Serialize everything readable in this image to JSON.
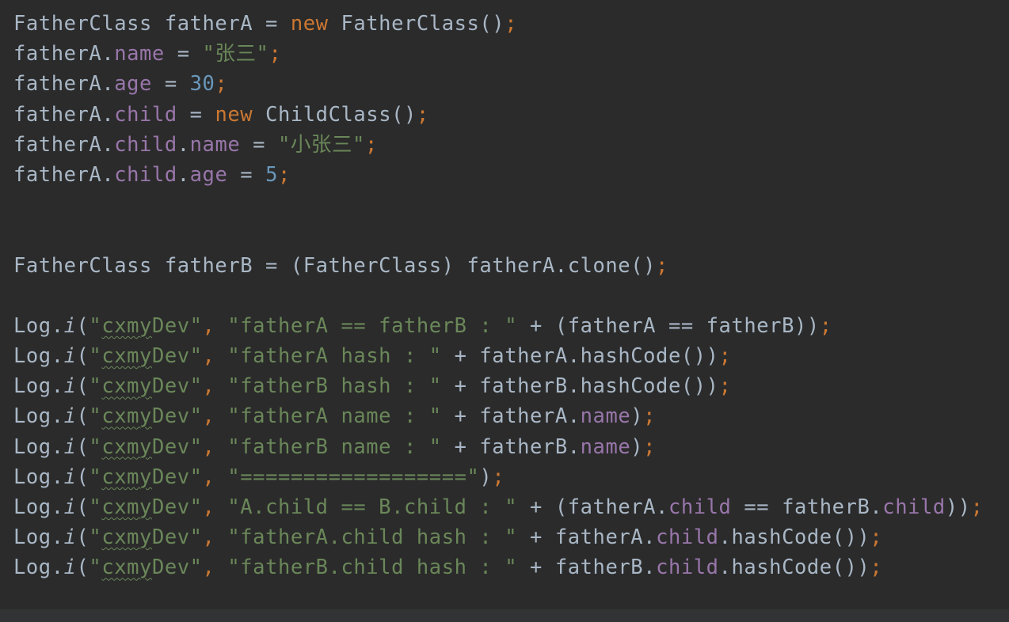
{
  "editor": {
    "colors": {
      "background": "#2b2b2b",
      "default_text": "#a9b7c6",
      "keyword": "#cc7832",
      "field": "#9876aa",
      "number": "#6897bb",
      "string": "#6a8759"
    },
    "lines": [
      [
        {
          "t": "FatherClass fatherA = ",
          "c": "plain"
        },
        {
          "t": "new",
          "c": "kw"
        },
        {
          "t": " FatherClass()",
          "c": "plain"
        },
        {
          "t": ";",
          "c": "punc"
        }
      ],
      [
        {
          "t": "fatherA.",
          "c": "plain"
        },
        {
          "t": "name",
          "c": "field"
        },
        {
          "t": " = ",
          "c": "plain"
        },
        {
          "t": "\"张三\"",
          "c": "str"
        },
        {
          "t": ";",
          "c": "punc"
        }
      ],
      [
        {
          "t": "fatherA.",
          "c": "plain"
        },
        {
          "t": "age",
          "c": "field"
        },
        {
          "t": " = ",
          "c": "plain"
        },
        {
          "t": "30",
          "c": "num"
        },
        {
          "t": ";",
          "c": "punc"
        }
      ],
      [
        {
          "t": "fatherA.",
          "c": "plain"
        },
        {
          "t": "child",
          "c": "field"
        },
        {
          "t": " = ",
          "c": "plain"
        },
        {
          "t": "new",
          "c": "kw"
        },
        {
          "t": " ChildClass()",
          "c": "plain"
        },
        {
          "t": ";",
          "c": "punc"
        }
      ],
      [
        {
          "t": "fatherA.",
          "c": "plain"
        },
        {
          "t": "child",
          "c": "field"
        },
        {
          "t": ".",
          "c": "plain"
        },
        {
          "t": "name",
          "c": "field"
        },
        {
          "t": " = ",
          "c": "plain"
        },
        {
          "t": "\"小张三\"",
          "c": "str"
        },
        {
          "t": ";",
          "c": "punc"
        }
      ],
      [
        {
          "t": "fatherA.",
          "c": "plain"
        },
        {
          "t": "child",
          "c": "field"
        },
        {
          "t": ".",
          "c": "plain"
        },
        {
          "t": "age",
          "c": "field"
        },
        {
          "t": " = ",
          "c": "plain"
        },
        {
          "t": "5",
          "c": "num"
        },
        {
          "t": ";",
          "c": "punc"
        }
      ],
      [],
      [],
      [
        {
          "t": "FatherClass fatherB = (FatherClass) fatherA.clone()",
          "c": "plain"
        },
        {
          "t": ";",
          "c": "punc"
        }
      ],
      [],
      [
        {
          "t": "Log.",
          "c": "plain"
        },
        {
          "t": "i",
          "c": "method"
        },
        {
          "t": "(",
          "c": "plain"
        },
        {
          "t": "\"",
          "c": "str"
        },
        {
          "t": "cxmy",
          "c": "str typo"
        },
        {
          "t": "Dev\"",
          "c": "str"
        },
        {
          "t": ", ",
          "c": "punc"
        },
        {
          "t": "\"fatherA == fatherB : \"",
          "c": "str"
        },
        {
          "t": " + (fatherA == fatherB))",
          "c": "plain"
        },
        {
          "t": ";",
          "c": "punc"
        }
      ],
      [
        {
          "t": "Log.",
          "c": "plain"
        },
        {
          "t": "i",
          "c": "method"
        },
        {
          "t": "(",
          "c": "plain"
        },
        {
          "t": "\"",
          "c": "str"
        },
        {
          "t": "cxmy",
          "c": "str typo"
        },
        {
          "t": "Dev\"",
          "c": "str"
        },
        {
          "t": ", ",
          "c": "punc"
        },
        {
          "t": "\"fatherA hash : \"",
          "c": "str"
        },
        {
          "t": " + fatherA.hashCode())",
          "c": "plain"
        },
        {
          "t": ";",
          "c": "punc"
        }
      ],
      [
        {
          "t": "Log.",
          "c": "plain"
        },
        {
          "t": "i",
          "c": "method"
        },
        {
          "t": "(",
          "c": "plain"
        },
        {
          "t": "\"",
          "c": "str"
        },
        {
          "t": "cxmy",
          "c": "str typo"
        },
        {
          "t": "Dev\"",
          "c": "str"
        },
        {
          "t": ", ",
          "c": "punc"
        },
        {
          "t": "\"fatherB hash : \"",
          "c": "str"
        },
        {
          "t": " + fatherB.hashCode())",
          "c": "plain"
        },
        {
          "t": ";",
          "c": "punc"
        }
      ],
      [
        {
          "t": "Log.",
          "c": "plain"
        },
        {
          "t": "i",
          "c": "method"
        },
        {
          "t": "(",
          "c": "plain"
        },
        {
          "t": "\"",
          "c": "str"
        },
        {
          "t": "cxmy",
          "c": "str typo"
        },
        {
          "t": "Dev\"",
          "c": "str"
        },
        {
          "t": ", ",
          "c": "punc"
        },
        {
          "t": "\"fatherA name : \"",
          "c": "str"
        },
        {
          "t": " + fatherA.",
          "c": "plain"
        },
        {
          "t": "name",
          "c": "field"
        },
        {
          "t": ")",
          "c": "plain"
        },
        {
          "t": ";",
          "c": "punc"
        }
      ],
      [
        {
          "t": "Log.",
          "c": "plain"
        },
        {
          "t": "i",
          "c": "method"
        },
        {
          "t": "(",
          "c": "plain"
        },
        {
          "t": "\"",
          "c": "str"
        },
        {
          "t": "cxmy",
          "c": "str typo"
        },
        {
          "t": "Dev\"",
          "c": "str"
        },
        {
          "t": ", ",
          "c": "punc"
        },
        {
          "t": "\"fatherB name : \"",
          "c": "str"
        },
        {
          "t": " + fatherB.",
          "c": "plain"
        },
        {
          "t": "name",
          "c": "field"
        },
        {
          "t": ")",
          "c": "plain"
        },
        {
          "t": ";",
          "c": "punc"
        }
      ],
      [
        {
          "t": "Log.",
          "c": "plain"
        },
        {
          "t": "i",
          "c": "method"
        },
        {
          "t": "(",
          "c": "plain"
        },
        {
          "t": "\"",
          "c": "str"
        },
        {
          "t": "cxmy",
          "c": "str typo"
        },
        {
          "t": "Dev\"",
          "c": "str"
        },
        {
          "t": ", ",
          "c": "punc"
        },
        {
          "t": "\"==================\"",
          "c": "str"
        },
        {
          "t": ")",
          "c": "plain"
        },
        {
          "t": ";",
          "c": "punc"
        }
      ],
      [
        {
          "t": "Log.",
          "c": "plain"
        },
        {
          "t": "i",
          "c": "method"
        },
        {
          "t": "(",
          "c": "plain"
        },
        {
          "t": "\"",
          "c": "str"
        },
        {
          "t": "cxmy",
          "c": "str typo"
        },
        {
          "t": "Dev\"",
          "c": "str"
        },
        {
          "t": ", ",
          "c": "punc"
        },
        {
          "t": "\"A.child == B.child : \"",
          "c": "str"
        },
        {
          "t": " + (fatherA.",
          "c": "plain"
        },
        {
          "t": "child",
          "c": "field"
        },
        {
          "t": " == fatherB.",
          "c": "plain"
        },
        {
          "t": "child",
          "c": "field"
        },
        {
          "t": "))",
          "c": "plain"
        },
        {
          "t": ";",
          "c": "punc"
        }
      ],
      [
        {
          "t": "Log.",
          "c": "plain"
        },
        {
          "t": "i",
          "c": "method"
        },
        {
          "t": "(",
          "c": "plain"
        },
        {
          "t": "\"",
          "c": "str"
        },
        {
          "t": "cxmy",
          "c": "str typo"
        },
        {
          "t": "Dev\"",
          "c": "str"
        },
        {
          "t": ", ",
          "c": "punc"
        },
        {
          "t": "\"fatherA.child hash : \"",
          "c": "str"
        },
        {
          "t": " + fatherA.",
          "c": "plain"
        },
        {
          "t": "child",
          "c": "field"
        },
        {
          "t": ".hashCode())",
          "c": "plain"
        },
        {
          "t": ";",
          "c": "punc"
        }
      ],
      [
        {
          "t": "Log.",
          "c": "plain"
        },
        {
          "t": "i",
          "c": "method"
        },
        {
          "t": "(",
          "c": "plain"
        },
        {
          "t": "\"",
          "c": "str"
        },
        {
          "t": "cxmy",
          "c": "str typo"
        },
        {
          "t": "Dev\"",
          "c": "str"
        },
        {
          "t": ", ",
          "c": "punc"
        },
        {
          "t": "\"fatherB.child hash : \"",
          "c": "str"
        },
        {
          "t": " + fatherB.",
          "c": "plain"
        },
        {
          "t": "child",
          "c": "field"
        },
        {
          "t": ".hashCode())",
          "c": "plain"
        },
        {
          "t": ";",
          "c": "punc"
        }
      ]
    ]
  }
}
